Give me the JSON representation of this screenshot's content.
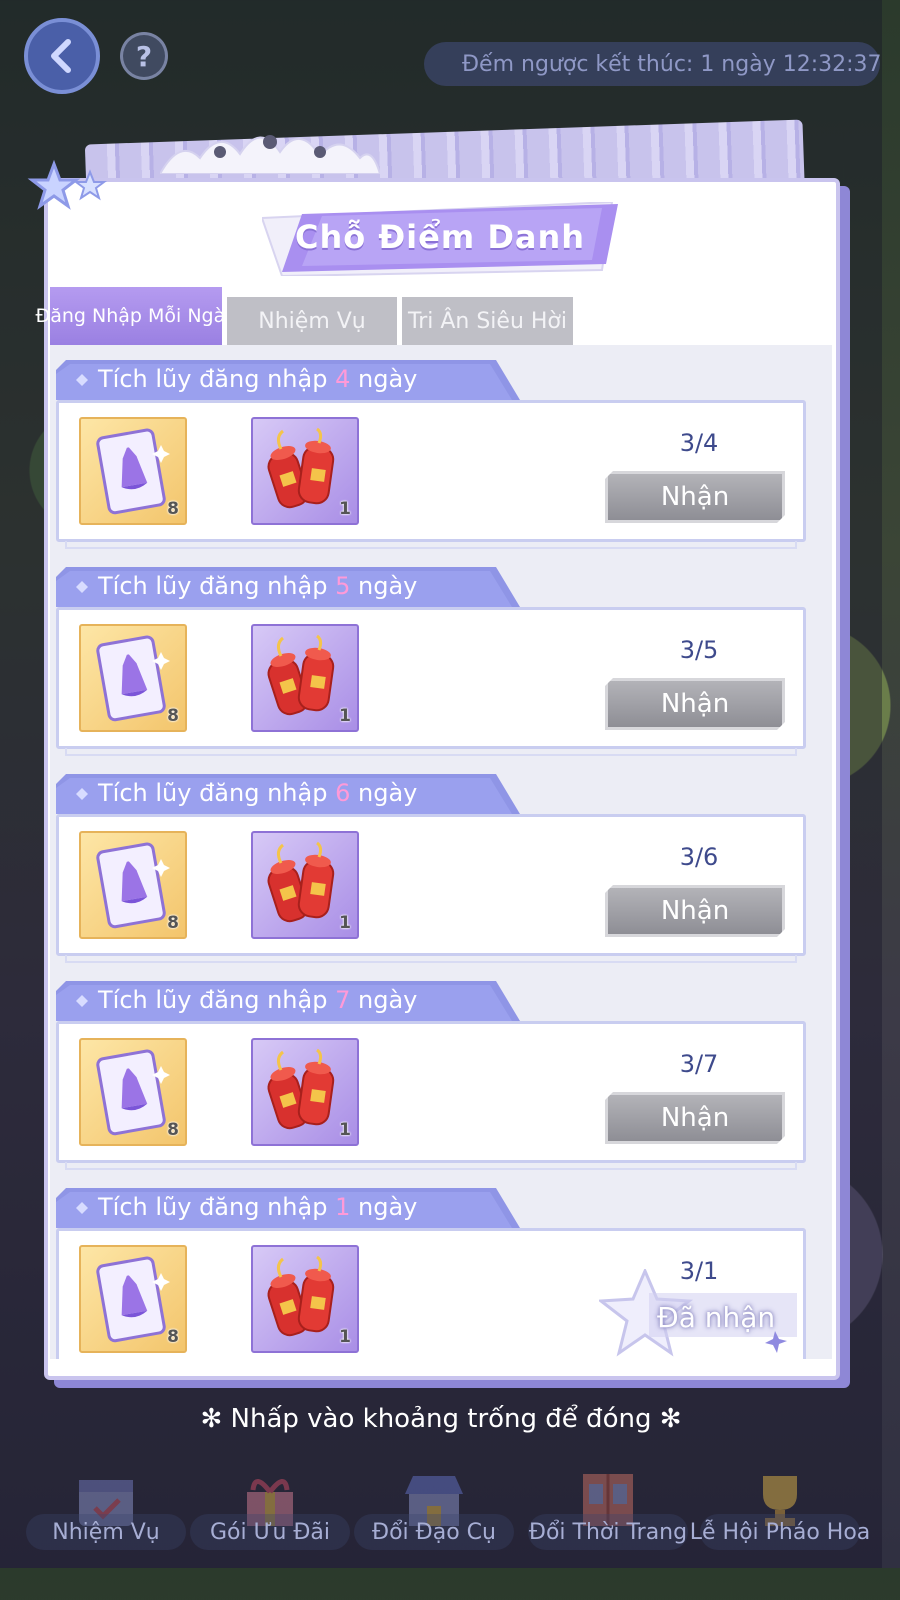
{
  "topbar": {
    "countdown_text": "Đếm ngược kết thúc: 1 ngày 12:32:37"
  },
  "panel": {
    "title": "Chỗ Điểm Danh",
    "tabs": [
      {
        "label": "Đăng Nhập Mỗi Ngày",
        "active": true
      },
      {
        "label": "Nhiệm Vụ",
        "active": false
      },
      {
        "label": "Tri Ân Siêu Hời",
        "active": false
      }
    ]
  },
  "tasks": [
    {
      "prefix": "Tích lũy đăng nhập ",
      "days": "4",
      "suffix": " ngày",
      "rewards": [
        {
          "icon": "dress-ticket-icon",
          "qty": "8"
        },
        {
          "icon": "firecracker-icon",
          "qty": "1"
        }
      ],
      "progress": "3/4",
      "button": "Nhận",
      "claimed": false
    },
    {
      "prefix": "Tích lũy đăng nhập ",
      "days": "5",
      "suffix": " ngày",
      "rewards": [
        {
          "icon": "dress-ticket-icon",
          "qty": "8"
        },
        {
          "icon": "firecracker-icon",
          "qty": "1"
        }
      ],
      "progress": "3/5",
      "button": "Nhận",
      "claimed": false
    },
    {
      "prefix": "Tích lũy đăng nhập ",
      "days": "6",
      "suffix": " ngày",
      "rewards": [
        {
          "icon": "dress-ticket-icon",
          "qty": "8"
        },
        {
          "icon": "firecracker-icon",
          "qty": "1"
        }
      ],
      "progress": "3/6",
      "button": "Nhận",
      "claimed": false
    },
    {
      "prefix": "Tích lũy đăng nhập ",
      "days": "7",
      "suffix": " ngày",
      "rewards": [
        {
          "icon": "dress-ticket-icon",
          "qty": "8"
        },
        {
          "icon": "firecracker-icon",
          "qty": "1"
        }
      ],
      "progress": "3/7",
      "button": "Nhận",
      "claimed": false
    },
    {
      "prefix": "Tích lũy đăng nhập ",
      "days": "1",
      "suffix": " ngày",
      "rewards": [
        {
          "icon": "dress-ticket-icon",
          "qty": "8"
        },
        {
          "icon": "firecracker-icon",
          "qty": "1"
        }
      ],
      "progress": "3/1",
      "button": "Đã nhận",
      "claimed": true
    }
  ],
  "close_hint": "Nhấp vào khoảng trống để đóng",
  "bottom_nav": [
    {
      "label": "Nhiệm Vụ",
      "icon": "calendar-icon"
    },
    {
      "label": "Gói Ưu Đãi",
      "icon": "gift-icon"
    },
    {
      "label": "Đổi Đạo Cụ",
      "icon": "shop-icon"
    },
    {
      "label": "Đổi Thời Trang",
      "icon": "wardrobe-icon"
    },
    {
      "label": "Lễ Hội Pháo Hoa",
      "icon": "trophy-icon"
    }
  ],
  "colors": {
    "accent_purple": "#9a80e2",
    "day_highlight": "#ff9ad8",
    "progress_text": "#3e4a8c",
    "disabled_button": "#9e9ea5"
  }
}
